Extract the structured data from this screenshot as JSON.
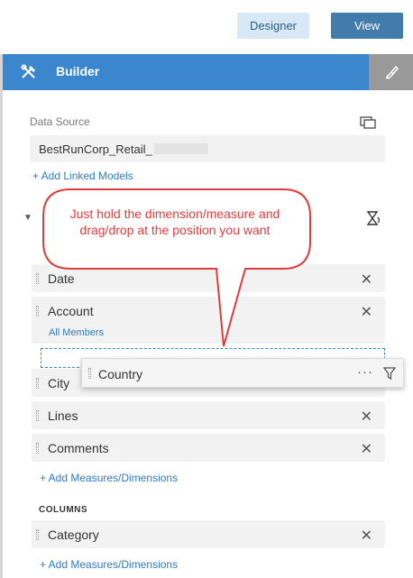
{
  "toolbar": {
    "designer_label": "Designer",
    "view_label": "View"
  },
  "builder": {
    "title": "Builder",
    "tools_icon": "tools-icon",
    "styling_icon": "paintbrush-icon"
  },
  "data_source": {
    "label": "Data Source",
    "value": "BestRunCorp_Retail_",
    "add_linked_models": "+ Add Linked Models"
  },
  "rows": {
    "items": [
      {
        "label": "Date"
      },
      {
        "label": "Account",
        "sub": "All Members"
      },
      {
        "label": "City"
      },
      {
        "label": "Lines"
      },
      {
        "label": "Comments"
      }
    ],
    "add_label": "+ Add Measures/Dimensions"
  },
  "dragging": {
    "label": "Country",
    "more": "···"
  },
  "columns": {
    "title": "COLUMNS",
    "items": [
      {
        "label": "Category"
      }
    ],
    "add_label": "+ Add Measures/Dimensions"
  },
  "callout": {
    "text": "Just hold the dimension/measure and drag/drop at the position you want",
    "color": "#e23b3b"
  },
  "colors": {
    "header_blue": "#3b86cd",
    "view_button": "#427cac",
    "designer_button": "#d9e8f6",
    "link": "#2e7bc4"
  }
}
